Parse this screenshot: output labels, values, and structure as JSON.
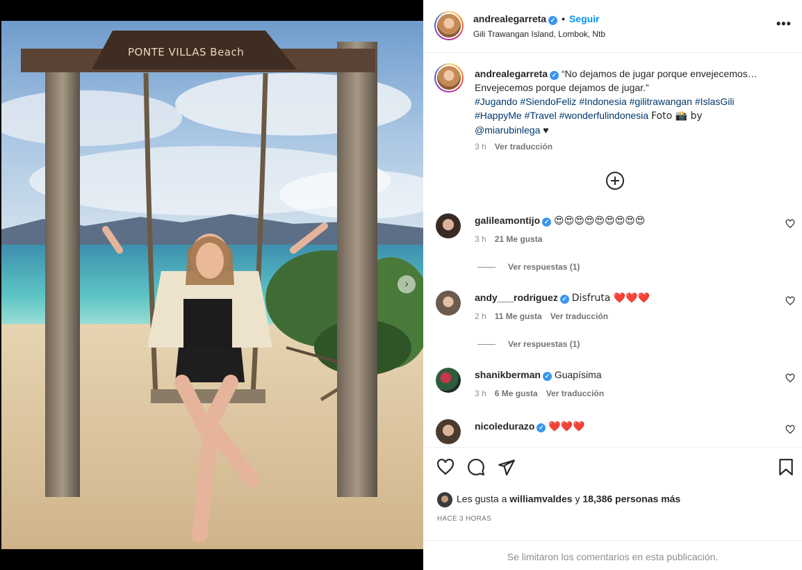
{
  "post": {
    "username": "andrealegarreta",
    "follow_label": "Seguir",
    "separator": "•",
    "location": "Gili Trawangan Island, Lombok, Ntb",
    "more_label": "•••"
  },
  "media": {
    "sign_text": "PONTE VILLAS  Beach",
    "next_label": "›"
  },
  "caption": {
    "username": "andrealegarreta",
    "text": "“No dejamos de jugar porque envejecemos… Envejecemos porque dejamos de jugar.”",
    "hashtags": [
      "#Jugando",
      "#SiendoFeliz",
      "#Indonesia",
      "#gilitrawangan",
      "#IslasGili",
      "#HappyMe",
      "#Travel",
      "#wonderfulindonesia"
    ],
    "photo_credit_prefix": "Foto 📸 by",
    "mention": "@miarubinlega",
    "trailing": "♥",
    "time": "3 h",
    "translate": "Ver traducción"
  },
  "comments": [
    {
      "username": "galileamontijo",
      "text": "😍😍😍😍😍😍😍😍😍",
      "time": "3 h",
      "likes": "21 Me gusta",
      "translate": "",
      "replies": "Ver respuestas (1)"
    },
    {
      "username": "andy___rodriguez",
      "text": "Disfruta ❤️❤️❤️",
      "time": "2 h",
      "likes": "11 Me gusta",
      "translate": "Ver traducción",
      "replies": "Ver respuestas (1)"
    },
    {
      "username": "shanikberman",
      "text": "Guapísima",
      "time": "3 h",
      "likes": "6 Me gusta",
      "translate": "Ver traducción",
      "replies": ""
    },
    {
      "username": "nicoledurazo",
      "text": "❤️❤️❤️",
      "time": "",
      "likes": "",
      "translate": "",
      "replies": ""
    }
  ],
  "footer": {
    "likes_prefix": "Les gusta a",
    "liked_by": "williamvaldes",
    "likes_connector": "y",
    "likes_count": "18,386 personas más",
    "time_ago": "HACE 3 HORAS",
    "comments_limited": "Se limitaron los comentarios en esta publicación."
  },
  "colors": {
    "accent": "#0095f6",
    "verified": "#3897f0",
    "hashtag": "#00376b",
    "heart": "#ed4956"
  },
  "icons": [
    "more-icon",
    "verified-icon",
    "add-circle-icon",
    "heart-icon",
    "comment-icon",
    "share-icon",
    "bookmark-icon"
  ]
}
